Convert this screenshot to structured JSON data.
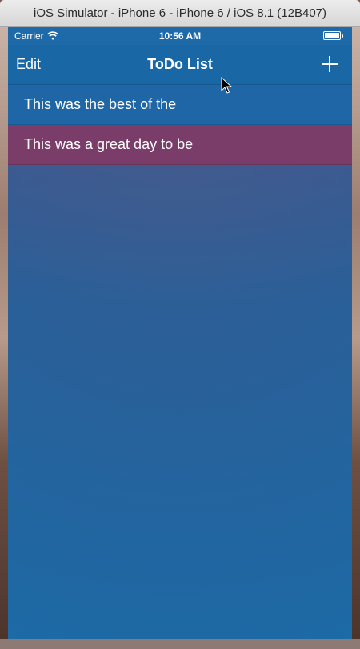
{
  "window": {
    "title": "iOS Simulator - iPhone 6 - iPhone 6 / iOS 8.1 (12B407)"
  },
  "status_bar": {
    "carrier": "Carrier",
    "time": "10:56 AM",
    "wifi_icon": "wifi-icon",
    "battery_icon": "battery-icon"
  },
  "nav": {
    "edit_label": "Edit",
    "title": "ToDo List",
    "add_icon": "plus-icon"
  },
  "todos": [
    {
      "text": "This was the best of the",
      "color": "#1f66a6"
    },
    {
      "text": "This was a great day to be",
      "color": "#7a3c68"
    }
  ],
  "colors": {
    "nav_background": "#1a67a6",
    "screen_background": "#1f6aa6"
  }
}
